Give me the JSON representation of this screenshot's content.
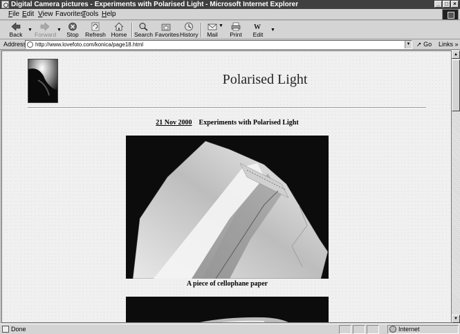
{
  "window": {
    "title": "Digital Camera pictures - Experiments with Polarised Light - Microsoft Internet Explorer",
    "controls": [
      "_",
      "□",
      "×"
    ]
  },
  "menu": {
    "items": [
      {
        "u": "F",
        "rest": "ile"
      },
      {
        "u": "E",
        "rest": "dit"
      },
      {
        "u": "V",
        "rest": "iew"
      },
      {
        "u": "",
        "rest": "Favorites"
      },
      {
        "u": "T",
        "rest": "ools"
      },
      {
        "u": "H",
        "rest": "elp"
      }
    ]
  },
  "toolbar": {
    "back": "Back",
    "forward": "Forward",
    "stop": "Stop",
    "refresh": "Refresh",
    "home": "Home",
    "search": "Search",
    "favorites": "Favorites",
    "history": "History",
    "mail": "Mail",
    "print": "Print",
    "edit": "Edit"
  },
  "address": {
    "label": "Address",
    "url": "http://www.lovefoto.com/konica/page18.html",
    "go": "Go",
    "links": "Links"
  },
  "page": {
    "heading": "Polarised Light",
    "date": "21 Nov 2000",
    "subtitle": "Experiments with Polarised Light",
    "caption": "A piece of cellophane paper"
  },
  "status": {
    "text": "Done",
    "zone": "Internet"
  }
}
